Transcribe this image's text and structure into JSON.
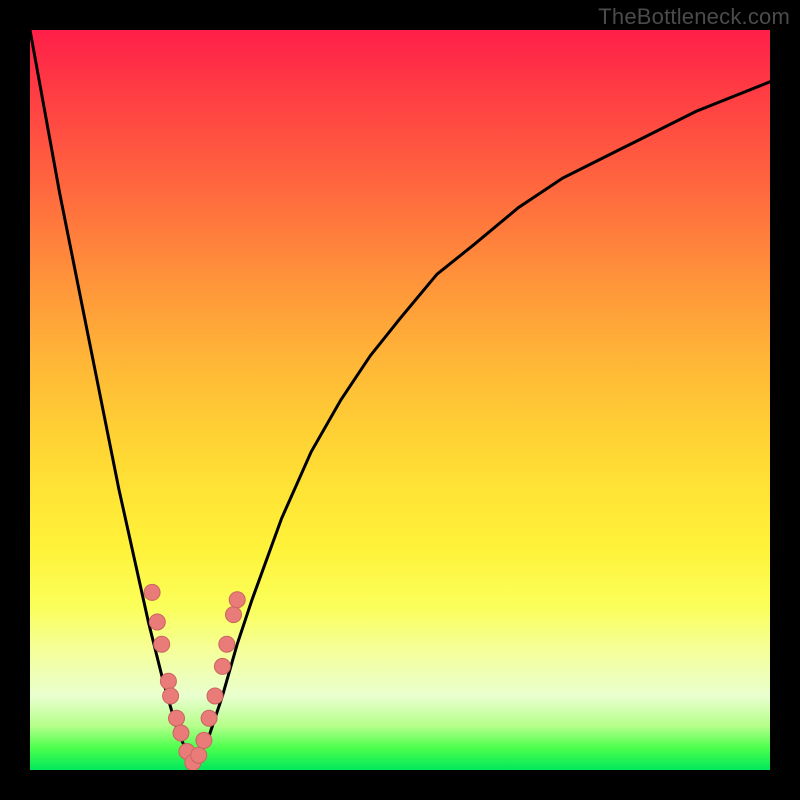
{
  "watermark": "TheBottleneck.com",
  "colors": {
    "frame": "#000000",
    "curve": "#000000",
    "marker_fill": "#e97b78",
    "marker_stroke": "#c96560",
    "gradient_stops": [
      "#ff1f49",
      "#ff6a3e",
      "#ffb437",
      "#fff23a",
      "#e9ffcf",
      "#00e85c"
    ]
  },
  "chart_data": {
    "type": "line",
    "title": "",
    "xlabel": "",
    "ylabel": "",
    "xlim": [
      0,
      100
    ],
    "ylim": [
      0,
      100
    ],
    "x_min_at": 22,
    "series": [
      {
        "name": "bottleneck-curve",
        "x": [
          0,
          2,
          4,
          6,
          8,
          10,
          12,
          14,
          16,
          18,
          20,
          22,
          24,
          26,
          28,
          30,
          34,
          38,
          42,
          46,
          50,
          55,
          60,
          66,
          72,
          80,
          90,
          100
        ],
        "y": [
          100,
          89,
          78,
          68,
          58,
          48,
          38,
          29,
          20,
          12,
          5,
          1,
          4,
          10,
          17,
          23,
          34,
          43,
          50,
          56,
          61,
          67,
          71,
          76,
          80,
          84,
          89,
          93
        ]
      }
    ],
    "markers": [
      {
        "x": 16.5,
        "y": 24
      },
      {
        "x": 17.2,
        "y": 20
      },
      {
        "x": 17.8,
        "y": 17
      },
      {
        "x": 18.7,
        "y": 12
      },
      {
        "x": 19.0,
        "y": 10
      },
      {
        "x": 19.8,
        "y": 7
      },
      {
        "x": 20.4,
        "y": 5
      },
      {
        "x": 21.2,
        "y": 2.5
      },
      {
        "x": 22.0,
        "y": 1
      },
      {
        "x": 22.8,
        "y": 2
      },
      {
        "x": 23.5,
        "y": 4
      },
      {
        "x": 24.2,
        "y": 7
      },
      {
        "x": 25.0,
        "y": 10
      },
      {
        "x": 26.0,
        "y": 14
      },
      {
        "x": 26.6,
        "y": 17
      },
      {
        "x": 27.5,
        "y": 21
      },
      {
        "x": 28.0,
        "y": 23
      }
    ]
  }
}
